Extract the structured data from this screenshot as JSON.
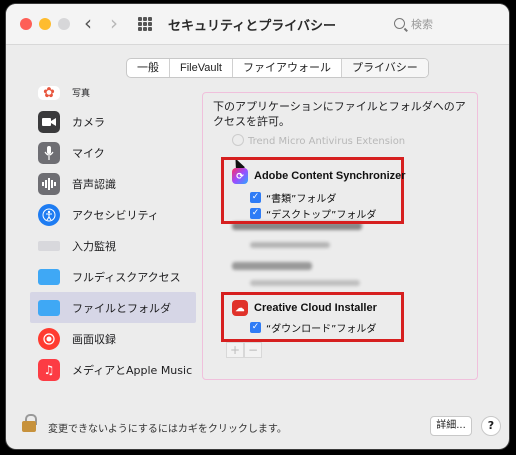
{
  "window": {
    "title": "セキュリティとプライバシー"
  },
  "search": {
    "placeholder": "検索"
  },
  "tabs": [
    {
      "label": "一般"
    },
    {
      "label": "FileVault"
    },
    {
      "label": "ファイアウォール"
    },
    {
      "label": "プライバシー"
    }
  ],
  "sidebar": {
    "items": [
      {
        "label": "写真",
        "icon": "photos-icon",
        "color": "#ffffff"
      },
      {
        "label": "カメラ",
        "icon": "camera-icon",
        "color": "#3a3a3c"
      },
      {
        "label": "マイク",
        "icon": "microphone-icon",
        "color": "#6e6e73"
      },
      {
        "label": "音声認識",
        "icon": "speech-recognition-icon",
        "color": "#6e6e73"
      },
      {
        "label": "アクセシビリティ",
        "icon": "accessibility-icon",
        "color": "#1e7cf2"
      },
      {
        "label": "入力監視",
        "icon": "keyboard-icon",
        "color": "#d8d8dc"
      },
      {
        "label": "フルディスクアクセス",
        "icon": "folder-icon",
        "color": "#3fa8f5"
      },
      {
        "label": "ファイルとフォルダ",
        "icon": "folder-icon",
        "color": "#3fa8f5"
      },
      {
        "label": "画面収録",
        "icon": "screen-recording-icon",
        "color": "#ff3b30"
      },
      {
        "label": "メディアとApple Music",
        "icon": "music-icon",
        "color": "#fc3c44"
      }
    ]
  },
  "panel": {
    "description": "下のアプリケーションにファイルとフォルダへのアクセスを許可。",
    "faded_top": "Trend Micro Antivirus Extension",
    "apps": [
      {
        "name": "Adobe Content Synchronizer",
        "icon": "adobe-sync-icon",
        "permissions": [
          "“書類”フォルダ",
          "“デスクトップ”フォルダ"
        ]
      },
      {
        "name": "Creative Cloud Installer",
        "icon": "creative-cloud-icon",
        "permissions": [
          "“ダウンロード”フォルダ"
        ]
      }
    ],
    "add_label": "+",
    "remove_label": "−"
  },
  "footer": {
    "lock_text": "変更できないようにするにはカギをクリックします。",
    "details_label": "詳細...",
    "help_label": "?"
  },
  "colors": {
    "highlight": "#d61f1f",
    "checkbox": "#2f7cf6"
  }
}
